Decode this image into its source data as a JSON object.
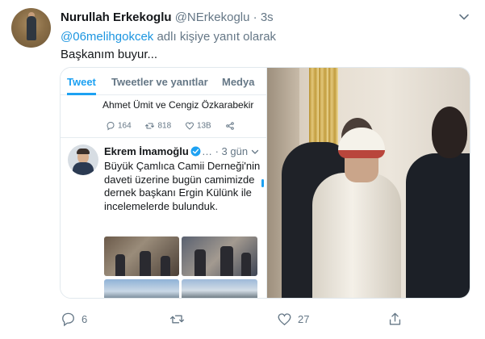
{
  "tweet": {
    "author_name": "Nurullah Erkekoglu",
    "handle": "@NErkekoglu",
    "separator": "·",
    "time": "3s",
    "reply_to_mention": "@06melihgokcek",
    "reply_suffix": " adlı kişiye yanıt olarak",
    "text": "Başkanım buyur..."
  },
  "screenshot": {
    "tabs": [
      "Tweet",
      "Tweetler ve yanıtlar",
      "Medya"
    ],
    "active_tab": "Tweet",
    "previous_tweet_text": "Ahmet Ümit ve Cengiz Özkarabekir",
    "previous_tweet_actions": {
      "replies": "164",
      "retweets": "818",
      "likes": "13B"
    },
    "quoted_name": "Ekrem İmamoğlu",
    "quoted_time": "… · 3 gün",
    "quoted_text": "Büyük Çamlıca Camii Derneği'nin daveti üzerine bugün camimizde dernek başkanı Ergin Külünk ile incelemelerde bulunduk."
  },
  "actions": {
    "replies": "6",
    "retweets": "",
    "likes": "27"
  },
  "colors": {
    "accent": "#1da1f2",
    "link": "#1b95e0",
    "secondary_text": "#657786"
  },
  "icons": [
    "chevron-down-icon",
    "reply-icon",
    "retweet-icon",
    "like-icon",
    "share-icon",
    "verified-icon"
  ]
}
